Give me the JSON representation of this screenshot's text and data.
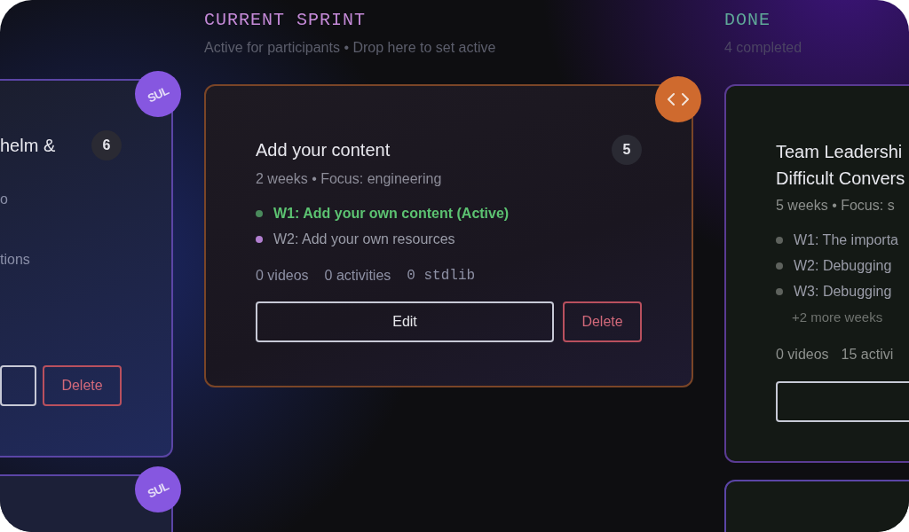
{
  "columns": [
    {
      "kind": "left",
      "cards": [
        {
          "kind": "partial",
          "corner": {
            "kind": "logo",
            "text": "SUL"
          },
          "title_lines": [
            "helm &"
          ],
          "badge": "6",
          "lines": [
            "o",
            "tions"
          ],
          "buttons": [
            {
              "kind": "edit"
            },
            {
              "kind": "delete",
              "label": "Delete"
            }
          ]
        },
        {
          "kind": "stub",
          "corner": {
            "kind": "logo",
            "text": "SUL"
          }
        }
      ]
    },
    {
      "kind": "center",
      "title": "CURRENT SPRINT",
      "subtitle": "Active for participants • Drop here to set active",
      "cards": [
        {
          "kind": "full",
          "corner": {
            "kind": "code"
          },
          "title_lines": [
            "Add your content"
          ],
          "badge": "5",
          "subtitle": "2 weeks • Focus: engineering",
          "weeks": [
            {
              "text": "W1: Add your own content (Active)",
              "color": "#4a8a5c",
              "active": true
            },
            {
              "text": "W2: Add your own resources",
              "color": "#b27fd0",
              "active": false
            }
          ],
          "stats": [
            {
              "text": "0 videos",
              "mono": false
            },
            {
              "text": "0 activities",
              "mono": false
            },
            {
              "text": "0 stdlib",
              "mono": true
            }
          ],
          "buttons": [
            {
              "kind": "edit",
              "label": "Edit"
            },
            {
              "kind": "delete",
              "label": "Delete"
            }
          ]
        }
      ]
    },
    {
      "kind": "right",
      "title": "DONE",
      "subtitle": "4 completed",
      "cards": [
        {
          "kind": "done",
          "title_lines": [
            "Team Leadershi",
            "Difficult Convers"
          ],
          "subtitle": "5 weeks • Focus: s",
          "weeks": [
            {
              "text": "W1: The importa",
              "color": "#5e625d",
              "active": false
            },
            {
              "text": "W2: Debugging",
              "color": "#5e625d",
              "active": false
            },
            {
              "text": "W3: Debugging",
              "color": "#5e625d",
              "active": false
            }
          ],
          "more": "+2 more weeks",
          "stats": [
            {
              "text": "0 videos",
              "mono": false
            },
            {
              "text": "15 activi",
              "mono": false
            }
          ],
          "buttons": [
            {
              "kind": "edit"
            }
          ]
        },
        {
          "kind": "stub"
        }
      ]
    }
  ]
}
